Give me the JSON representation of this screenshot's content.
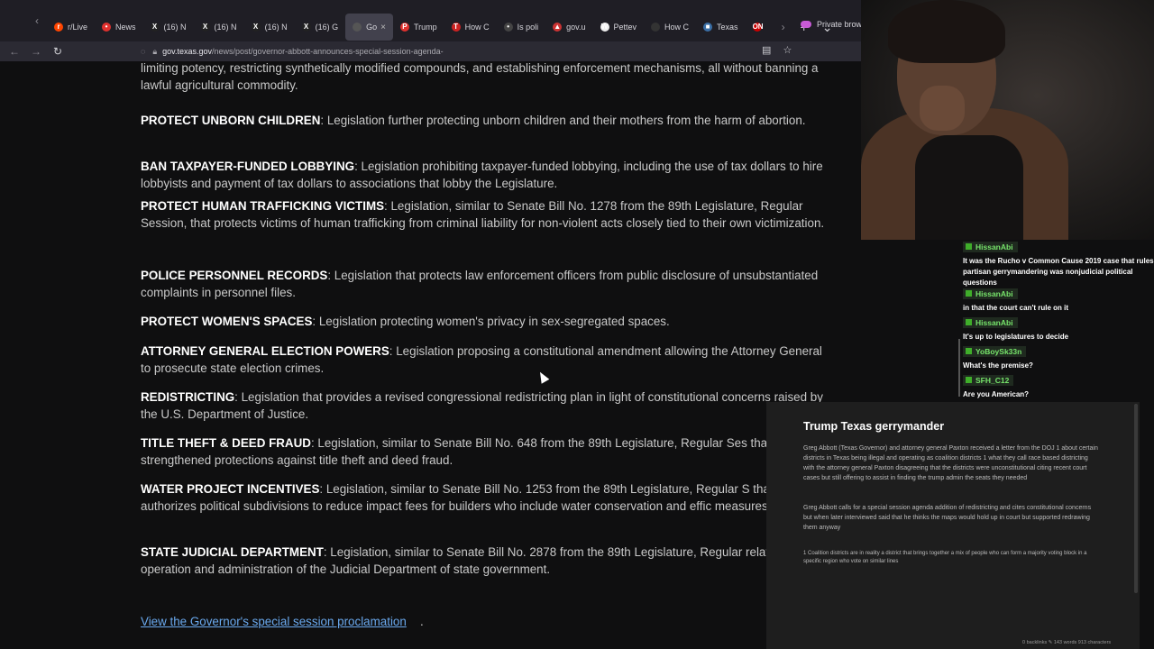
{
  "browser": {
    "tabs": [
      {
        "label": "r/Live",
        "fav_color": "#ff4500",
        "fav_char": "r"
      },
      {
        "label": "News",
        "fav_color": "#e0312e",
        "fav_char": "•"
      },
      {
        "label": "(16) N",
        "fav_color": "#222222",
        "fav_char": "X"
      },
      {
        "label": "(16) N",
        "fav_color": "#222222",
        "fav_char": "X"
      },
      {
        "label": "(16) N",
        "fav_color": "#222222",
        "fav_char": "X"
      },
      {
        "label": "(16) G",
        "fav_color": "#222222",
        "fav_char": "X"
      },
      {
        "label": "Go",
        "fav_color": "#555555",
        "fav_char": "",
        "active": true
      },
      {
        "label": "Trump",
        "fav_color": "#e0312e",
        "fav_char": "P"
      },
      {
        "label": "How C",
        "fav_color": "#cc2222",
        "fav_char": "T"
      },
      {
        "label": "Is poli",
        "fav_color": "#444444",
        "fav_char": "•"
      },
      {
        "label": "gov.u",
        "fav_color": "#cc3333",
        "fav_char": "▲"
      },
      {
        "label": "Pettev",
        "fav_color": "#eeeeee",
        "fav_char": "W"
      },
      {
        "label": "How C",
        "fav_color": "#333333",
        "fav_char": ""
      },
      {
        "label": "Texas",
        "fav_color": "#3a6ea5",
        "fav_char": "■"
      },
      {
        "label": "",
        "fav_color": "#cc0000",
        "fav_char": "ON"
      }
    ],
    "private_label": "Private browsi",
    "url_host": "gov.texas.gov",
    "url_path": "/news/post/governor-abbott-announces-special-session-agenda-"
  },
  "article": {
    "intro_tail": "limiting potency, restricting synthetically modified compounds, and establishing enforcement mechanisms, all without banning a lawful agricultural commodity.",
    "items": [
      {
        "term": "PROTECT UNBORN CHILDREN",
        "desc": ": Legislation further protecting unborn children and their mothers from the harm of abortion."
      },
      {
        "term": "BAN TAXPAYER-FUNDED LOBBYING",
        "desc": ": Legislation prohibiting taxpayer-funded lobbying, including the use of tax dollars to hire lobbyists and payment of tax dollars to associations that lobby the Legislature."
      },
      {
        "term": "PROTECT HUMAN TRAFFICKING VICTIMS",
        "desc": ": Legislation, similar to Senate Bill No. 1278 from the 89th Legislature, Regular Session, that protects victims of human trafficking from criminal liability for non-violent acts closely tied to their own victimization."
      },
      {
        "term": "POLICE PERSONNEL RECORDS",
        "desc": ": Legislation that protects law enforcement officers from public disclosure of unsubstantiated complaints in personnel files."
      },
      {
        "term": "PROTECT WOMEN'S SPACES",
        "desc": ": Legislation protecting women's privacy in sex-segregated spaces."
      },
      {
        "term": "ATTORNEY GENERAL ELECTION POWERS",
        "desc": ": Legislation proposing a constitutional amendment allowing the Attorney General to prosecute state election crimes."
      },
      {
        "term": "REDISTRICTING",
        "desc": ": Legislation that provides a revised congressional redistricting plan in light of constitutional concerns raised by the U.S. Department of Justice."
      },
      {
        "term": "TITLE THEFT & DEED FRAUD",
        "desc": ": Legislation, similar to Senate Bill No. 648 from the 89th Legislature, Regular Ses that provides strengthened protections against title theft and deed fraud."
      },
      {
        "term": "WATER PROJECT INCENTIVES",
        "desc": ": Legislation, similar to Senate Bill No. 1253 from the 89th Legislature, Regular S that authorizes political subdivisions to reduce impact fees for builders who include water conservation and effic measures."
      },
      {
        "term": "STATE JUDICIAL DEPARTMENT",
        "desc": ": Legislation, similar to Senate Bill No. 2878 from the 89th Legislature, Regular relating to the operation and administration of the Judicial Department of state government."
      }
    ],
    "proclamation_link": "View the Governor's special session proclamation",
    "proclamation_tail": "."
  },
  "chat": {
    "messages": [
      {
        "user": "HissanAbi",
        "text": "It was the Rucho v Common Cause 2019 case that rules partisan gerrymandering was nonjudicial political questions"
      },
      {
        "user": "HissanAbi",
        "text": "in that the court can't rule on it"
      },
      {
        "user": "HissanAbi",
        "text": "It's up to legislatures to decide"
      },
      {
        "user": "YoBoySk33n",
        "text": "What's the premise?"
      },
      {
        "user": "SFH_C12",
        "text": "Are you American?"
      }
    ]
  },
  "notes": {
    "title": "Trump Texas gerrymander",
    "p1": "Greg Abbott (Texas Governor) and attorney general Paxton received a letter from the DOJ 1 about certain districts in Texas being illegal and operating as coalition districts 1 what they call race based districting with the attorney general Paxton disagreeing that the districts were unconstitutional citing recent court cases but still offering to assist in finding the trump admin the seats they needed",
    "p2": "Greg Abbott calls for a special session agenda addition of redistricting and cites constitutional concerns but when later interviewed said that he thinks the maps would hold up in court but supported redrawing them anyway",
    "footnote": "1 Coalition districts are in reality a district that brings together a mix of people who can form a majority voting block in a specific region who vote on similar lines",
    "footer": "0 backlinks  ✎ 143 words  913 characters"
  }
}
